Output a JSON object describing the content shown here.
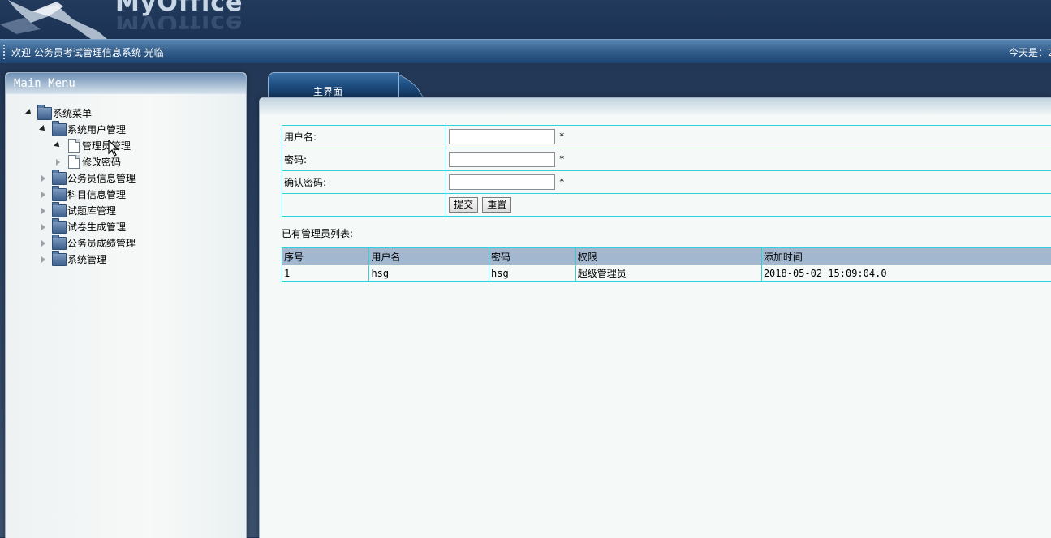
{
  "header": {
    "logo_text": "MyOffice",
    "welcome": "欢迎 公务员考试管理信息系统 光临",
    "today": "今天是：2"
  },
  "sidebar": {
    "title": "Main Menu",
    "tree": [
      {
        "label": "系统菜单",
        "icon": "folder-icon",
        "level": 0,
        "expanded": true
      },
      {
        "label": "系统用户管理",
        "icon": "folder-icon",
        "level": 1,
        "expanded": true
      },
      {
        "label": "管理员管理",
        "icon": "document-icon",
        "level": 2,
        "selected": true
      },
      {
        "label": "修改密码",
        "icon": "document-icon",
        "level": 2
      },
      {
        "label": "公务员信息管理",
        "icon": "folder-icon",
        "level": 1,
        "expanded": false
      },
      {
        "label": "科目信息管理",
        "icon": "folder-icon",
        "level": 1,
        "expanded": false
      },
      {
        "label": "试题库管理",
        "icon": "folder-icon",
        "level": 1,
        "expanded": false
      },
      {
        "label": "试卷生成管理",
        "icon": "folder-icon",
        "level": 1,
        "expanded": false
      },
      {
        "label": "公务员成绩管理",
        "icon": "folder-icon",
        "level": 1,
        "expanded": false
      },
      {
        "label": "系统管理",
        "icon": "folder-icon",
        "level": 1,
        "expanded": false
      }
    ]
  },
  "main": {
    "tab_label": "主界面",
    "form": {
      "username_label": "用户名:",
      "password_label": "密码:",
      "confirm_label": "确认密码:",
      "username_value": "",
      "password_value": "",
      "confirm_value": "",
      "required_mark": "*",
      "submit_label": "提交",
      "reset_label": "重置"
    },
    "list_title": "已有管理员列表:",
    "table": {
      "headers": [
        "序号",
        "用户名",
        "密码",
        "权限",
        "添加时间"
      ],
      "rows": [
        [
          "1",
          "hsg",
          "hsg",
          "超级管理员",
          "2018-05-02 15:09:04.0"
        ]
      ]
    }
  },
  "colors": {
    "table_border": "#32d3d8",
    "table_header_bg": "#a3b7cf",
    "panel_bg": "#f5faf9"
  }
}
